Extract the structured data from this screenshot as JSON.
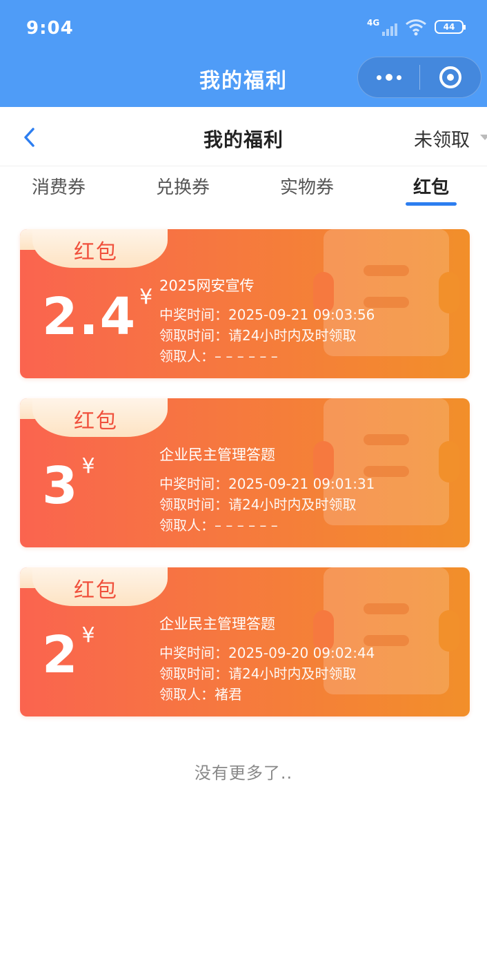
{
  "status_bar": {
    "time": "9:04",
    "network": "4G",
    "battery": "44",
    "icons": [
      "signal-icon",
      "wifi-icon",
      "battery-icon"
    ]
  },
  "app_header": {
    "title": "我的福利",
    "background": "#4f9cf7",
    "capsule": [
      "more-icon",
      "close-target-icon"
    ]
  },
  "page_nav": {
    "title": "我的福利",
    "filter_label": "未领取"
  },
  "tabs": [
    {
      "label": "消费券",
      "active": false
    },
    {
      "label": "兑换券",
      "active": false
    },
    {
      "label": "实物券",
      "active": false
    },
    {
      "label": "红包",
      "active": true
    }
  ],
  "cards": [
    {
      "tag": "红包",
      "amount": "2.4",
      "currency": "¥",
      "name": "2025网安宣传",
      "win_time": "中奖时间：2025-09-21 09:03:56",
      "claim_time": "领取时间：请24小时内及时领取",
      "claimer": "领取人：– – – – – –"
    },
    {
      "tag": "红包",
      "amount": "3",
      "currency": "¥",
      "name": "企业民主管理答题",
      "win_time": "中奖时间：2025-09-21 09:01:31",
      "claim_time": "领取时间：请24小时内及时领取",
      "claimer": "领取人：– – – – – –"
    },
    {
      "tag": "红包",
      "amount": "2",
      "currency": "¥",
      "name": "企业民主管理答题",
      "win_time": "中奖时间：2025-09-20 09:02:44",
      "claim_time": "领取时间：请24小时内及时领取",
      "claimer": "领取人：褚君"
    }
  ],
  "footer": {
    "no_more": "没有更多了.."
  },
  "colors": {
    "accent_blue": "#2d7ef0",
    "card_start": "#fa644f",
    "card_end": "#f28f2a"
  }
}
